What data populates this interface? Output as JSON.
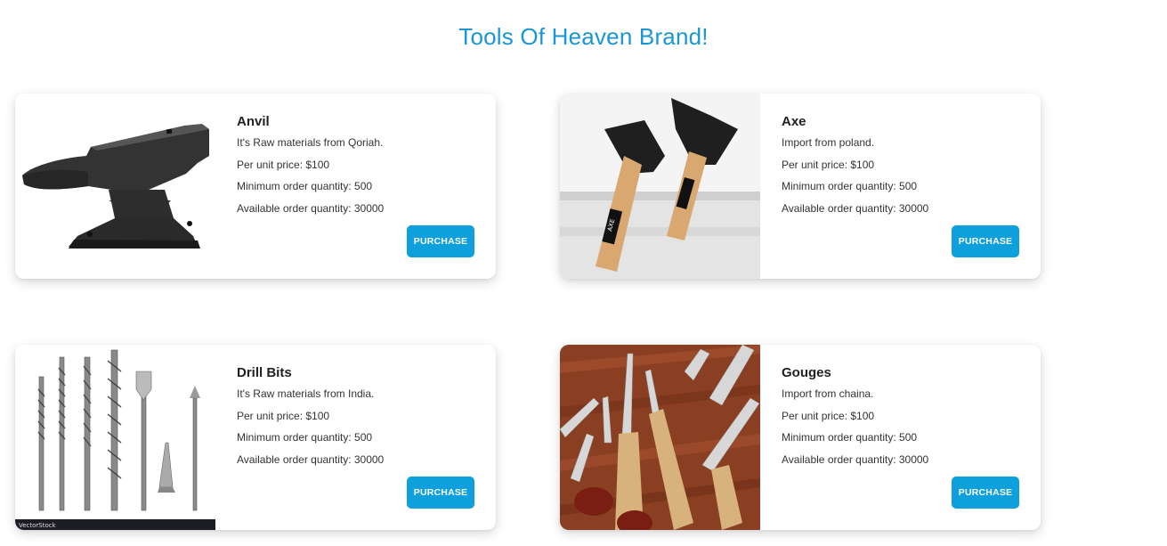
{
  "page": {
    "title": "Tools Of Heaven Brand!"
  },
  "products": [
    {
      "name": "Anvil",
      "description": "It's Raw materials from Qoriah.",
      "price": "Per unit price: $100",
      "min_order": "Minimum order quantity: 500",
      "available": "Available order quantity: 30000",
      "button": "PURCHASE"
    },
    {
      "name": "Axe",
      "description": "Import from poland.",
      "price": "Per unit price: $100",
      "min_order": "Minimum order quantity: 500",
      "available": "Available order quantity: 30000",
      "button": "PURCHASE",
      "image_text": "AXE"
    },
    {
      "name": "Drill Bits",
      "description": "It's Raw materials from India.",
      "price": "Per unit price: $100",
      "min_order": "Minimum order quantity: 500",
      "available": "Available order quantity: 30000",
      "button": "PURCHASE",
      "image_watermark": "VectorStock"
    },
    {
      "name": "Gouges",
      "description": "Import from chaina.",
      "price": "Per unit price: $100",
      "min_order": "Minimum order quantity: 500",
      "available": "Available order quantity: 30000",
      "button": "PURCHASE"
    }
  ],
  "colors": {
    "accent": "#1a96d4",
    "button": "#0ea0dc"
  }
}
